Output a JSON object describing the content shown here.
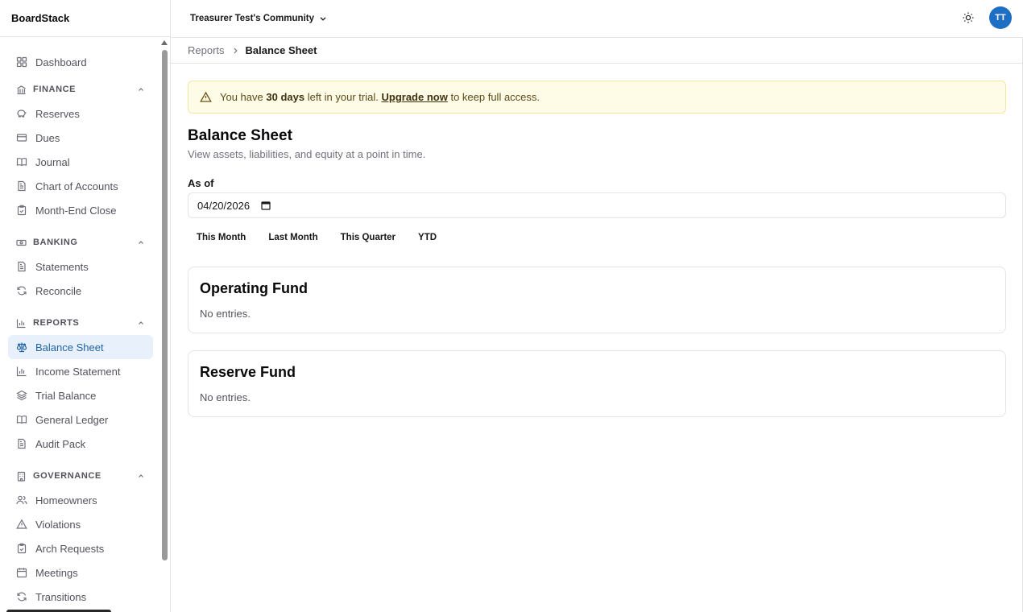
{
  "app": {
    "brand": "BoardStack"
  },
  "topbar": {
    "community": "Treasurer Test's Community",
    "avatar_initials": "TT",
    "theme_icon": "sun-icon"
  },
  "colors": {
    "accent": "#1d6fc4",
    "active_bg": "#e8f1fb",
    "trial_bg": "#fefbe6"
  },
  "sidebar": {
    "dashboard": "Dashboard",
    "finance": {
      "title": "FINANCE",
      "items": [
        "Reserves",
        "Dues",
        "Journal",
        "Chart of Accounts",
        "Month-End Close"
      ]
    },
    "banking": {
      "title": "BANKING",
      "items": [
        "Statements",
        "Reconcile"
      ]
    },
    "reports": {
      "title": "REPORTS",
      "items": [
        "Balance Sheet",
        "Income Statement",
        "Trial Balance",
        "General Ledger",
        "Audit Pack"
      ],
      "active": "Balance Sheet"
    },
    "governance": {
      "title": "GOVERNANCE",
      "items": [
        "Homeowners",
        "Violations",
        "Arch Requests",
        "Meetings",
        "Transitions"
      ]
    }
  },
  "breadcrumb": {
    "parent": "Reports",
    "current": "Balance Sheet"
  },
  "trial": {
    "prefix": "You have",
    "days": "30 days",
    "middle": "left in your trial.",
    "link": "Upgrade now",
    "suffix": "to keep full access."
  },
  "page": {
    "title": "Balance Sheet",
    "subtitle": "View assets, liabilities, and equity at a point in time.",
    "as_of_label": "As of",
    "as_of_value": "04/20/2026",
    "presets": [
      "This Month",
      "Last Month",
      "This Quarter",
      "YTD"
    ]
  },
  "funds": [
    {
      "name": "Operating Fund",
      "empty": "No entries."
    },
    {
      "name": "Reserve Fund",
      "empty": "No entries."
    }
  ]
}
